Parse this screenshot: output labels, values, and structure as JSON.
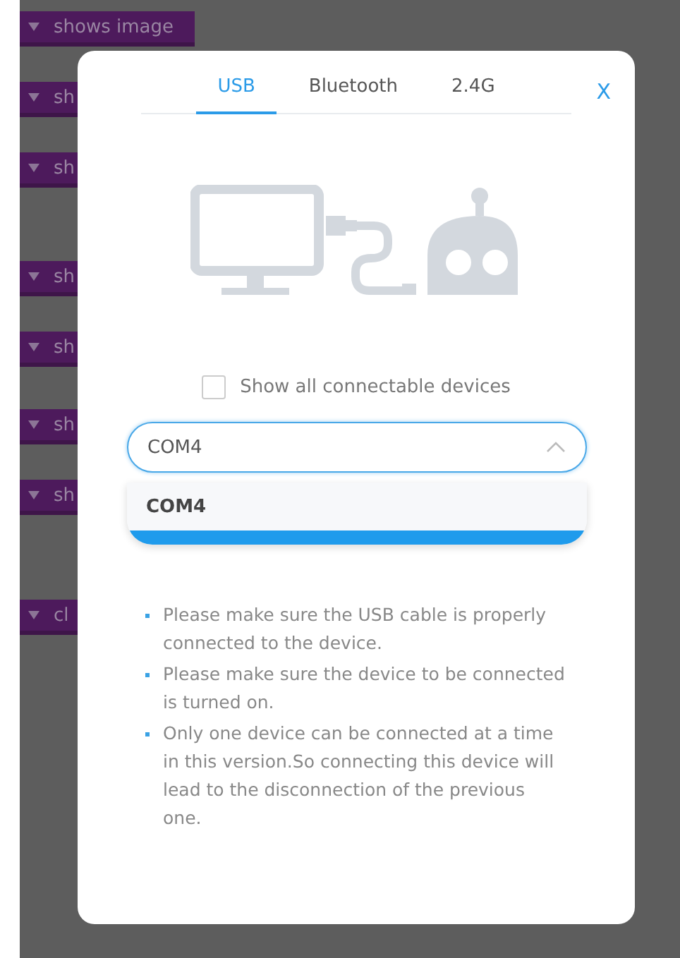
{
  "background_blocks": [
    {
      "label": "shows image"
    },
    {
      "label": "sh"
    },
    {
      "label": "sh"
    },
    {
      "label": "sh"
    },
    {
      "label": "sh"
    },
    {
      "label": "sh"
    },
    {
      "label": "sh"
    },
    {
      "label": "cl"
    }
  ],
  "dialog": {
    "tabs": [
      {
        "label": "USB",
        "selected": true
      },
      {
        "label": "Bluetooth",
        "selected": false
      },
      {
        "label": "2.4G",
        "selected": false
      }
    ],
    "close": "X",
    "show_all": {
      "label": "Show all connectable devices",
      "checked": false
    },
    "port_select": {
      "value": "COM4",
      "expanded": true,
      "options": [
        {
          "label": "COM4",
          "selected": true
        }
      ]
    },
    "notes": [
      "Please make sure the USB cable is properly connected to the device.",
      "Please make sure the device to be connected is turned on.",
      "Only one device can be connected at a time in this version.So connecting this device will lead to the disconnection of the previous one."
    ]
  }
}
